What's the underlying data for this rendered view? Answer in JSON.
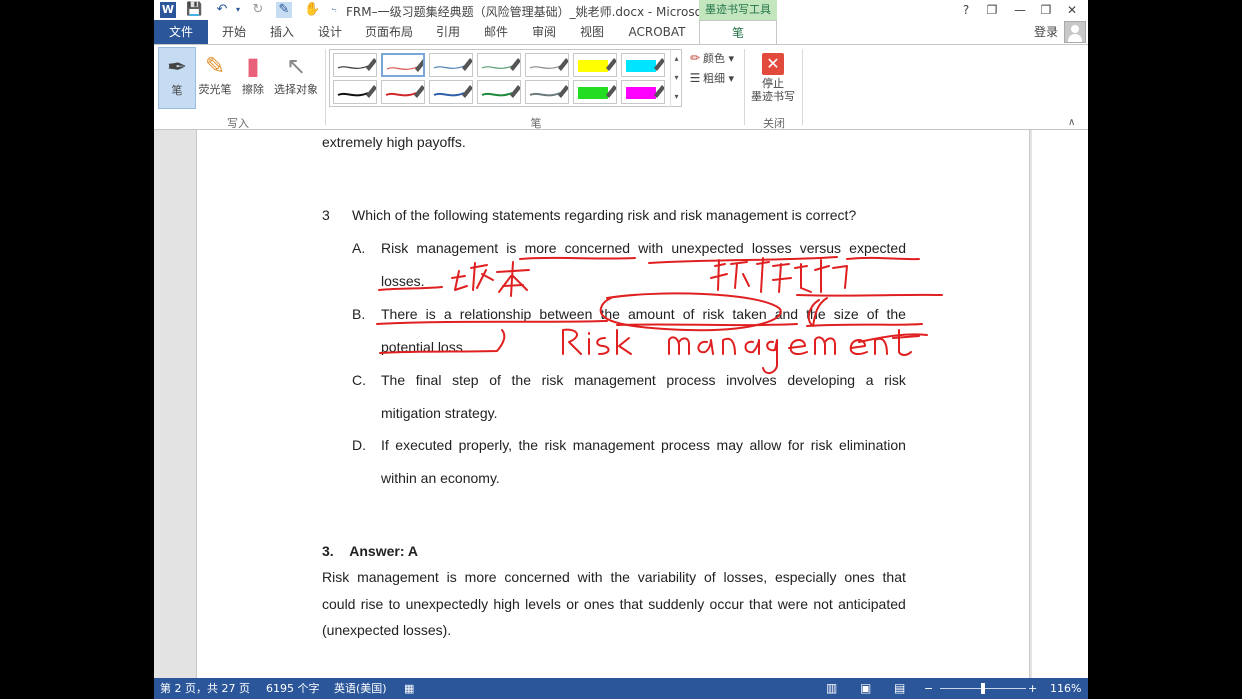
{
  "window": {
    "title": "FRM–一级习题集经典题（风险管理基础）_姚老师.docx - Microsoft ...",
    "contextual_group": "墨迹书写工具",
    "help": "?",
    "restore_ribbon": "❐",
    "minimize": "—",
    "maximize": "❒",
    "close": "✕"
  },
  "qat": {
    "save_icon": "floppy",
    "undo_icon": "undo",
    "redo_icon": "redo",
    "pen_icon": "pen",
    "touch_icon": "touch",
    "customize": "⨫"
  },
  "tabs": [
    "文件",
    "开始",
    "插入",
    "设计",
    "页面布局",
    "引用",
    "邮件",
    "审阅",
    "视图",
    "ACROBAT",
    "笔"
  ],
  "user": {
    "login": "登录"
  },
  "ribbon": {
    "write_group": {
      "label": "写入",
      "pen": "笔",
      "highlighter": "荧光笔",
      "eraser": "擦除",
      "select": "选择对象"
    },
    "pens_group": {
      "label": "笔",
      "color": "颜色",
      "thickness": "粗细",
      "swatches": [
        {
          "color": "#333333",
          "kind": "pen"
        },
        {
          "color": "#d9534f",
          "kind": "pen",
          "selected": true
        },
        {
          "color": "#4a7fb5",
          "kind": "pen"
        },
        {
          "color": "#5a9e6f",
          "kind": "pen"
        },
        {
          "color": "#8a8a8a",
          "kind": "pen"
        },
        {
          "color": "#ffff00",
          "kind": "highlighter"
        },
        {
          "color": "#00e5ff",
          "kind": "highlighter"
        },
        {
          "color": "#111111",
          "kind": "pen"
        },
        {
          "color": "#d0282a",
          "kind": "pen"
        },
        {
          "color": "#2f5fa8",
          "kind": "pen"
        },
        {
          "color": "#1e8a3c",
          "kind": "pen"
        },
        {
          "color": "#6a7a7a",
          "kind": "pen"
        },
        {
          "color": "#22dd22",
          "kind": "highlighter"
        },
        {
          "color": "#ff00ff",
          "kind": "highlighter"
        }
      ]
    },
    "close_group": {
      "label": "关闭",
      "stop_line1": "停止",
      "stop_line2": "墨迹书写"
    }
  },
  "document": {
    "prev_tail": "extremely high payoffs.",
    "question": {
      "number": "3",
      "stem": "Which of the following statements regarding risk and risk management is correct?",
      "options": [
        {
          "letter": "A.",
          "line1": "Risk management is more concerned with unexpected losses versus expected",
          "line2": "losses."
        },
        {
          "letter": "B.",
          "line1": "There is a relationship between the amount of risk taken and the size of the",
          "line2": "potential loss."
        },
        {
          "letter": "C.",
          "line1": "The final step of the risk management process involves developing a risk",
          "line2": "mitigation strategy."
        },
        {
          "letter": "D.",
          "line1": "If executed properly, the risk management process may allow for risk elimination",
          "line2": "within an economy."
        }
      ]
    },
    "answer": {
      "number": "3.",
      "title": "Answer: A",
      "line1": "Risk management is more concerned with the variability of losses, especially ones that",
      "line2": "could rise to unexpectedly high levels or ones that suddenly occur that were not anticipated",
      "line3": "(unexpected losses)."
    },
    "ink_color": "#e02020"
  },
  "statusbar": {
    "page": "第 2 页，共 27 页",
    "words": "6195 个字",
    "language": "英语(美国)",
    "zoom": "116%",
    "zoom_fraction": 0.5
  }
}
